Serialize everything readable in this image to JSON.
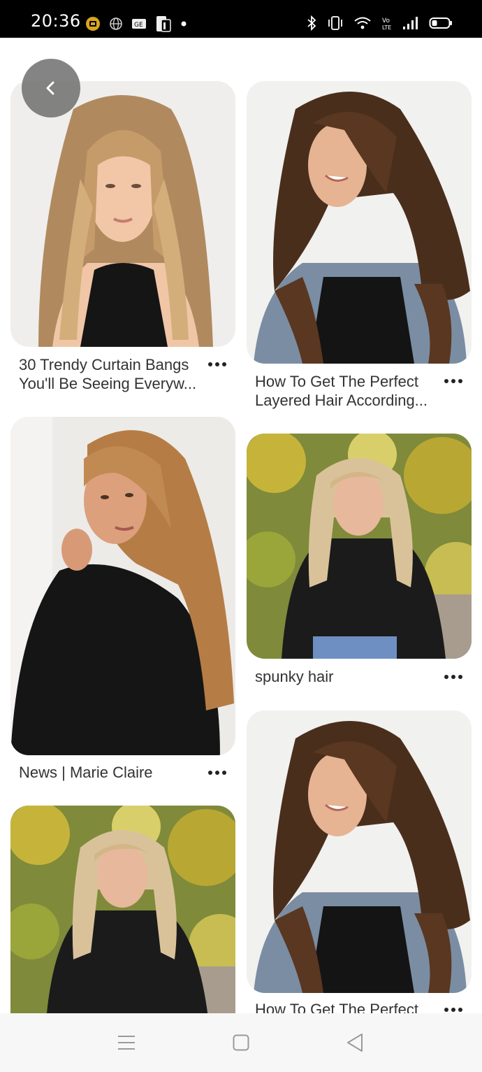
{
  "status_bar": {
    "time": "20:36",
    "left_icons": [
      "notification-icon",
      "globe-icon",
      "card-icon",
      "sim-icon",
      "dot-icon"
    ],
    "right_icons": [
      "bluetooth-icon",
      "vibrate-icon",
      "wifi-icon",
      "volte-icon",
      "signal-icon",
      "battery-icon"
    ],
    "volte_label": "Vo LTE"
  },
  "back_button": {
    "icon": "chevron-left-icon"
  },
  "pins": [
    {
      "title_line1": "30 Trendy Curtain Bangs",
      "title_line2": "You'll Be Seeing Everyw...",
      "image": "blonde-curtain-bangs-photo"
    },
    {
      "title_line1": "How To Get The Perfect",
      "title_line2": "Layered Hair According...",
      "image": "brunette-layered-hair-photo"
    },
    {
      "title_line1": "News | Marie Claire",
      "title_line2": "",
      "image": "caramel-long-hair-photo"
    },
    {
      "title_line1": "spunky hair",
      "title_line2": "",
      "image": "blonde-waves-autumn-photo"
    },
    {
      "title_line1": "",
      "title_line2": "",
      "image": "blonde-waves-autumn-photo-2"
    },
    {
      "title_line1": "How To Get The Perfect",
      "title_line2": "",
      "image": "brunette-layered-hair-photo-2"
    }
  ],
  "nav_bar": {
    "items": [
      "menu-icon",
      "home-square-icon",
      "back-triangle-icon"
    ]
  },
  "colors": {
    "status_bar_bg": "#000000",
    "page_bg": "#ffffff",
    "caption_text": "#333333",
    "nav_bg": "#f7f7f7"
  }
}
